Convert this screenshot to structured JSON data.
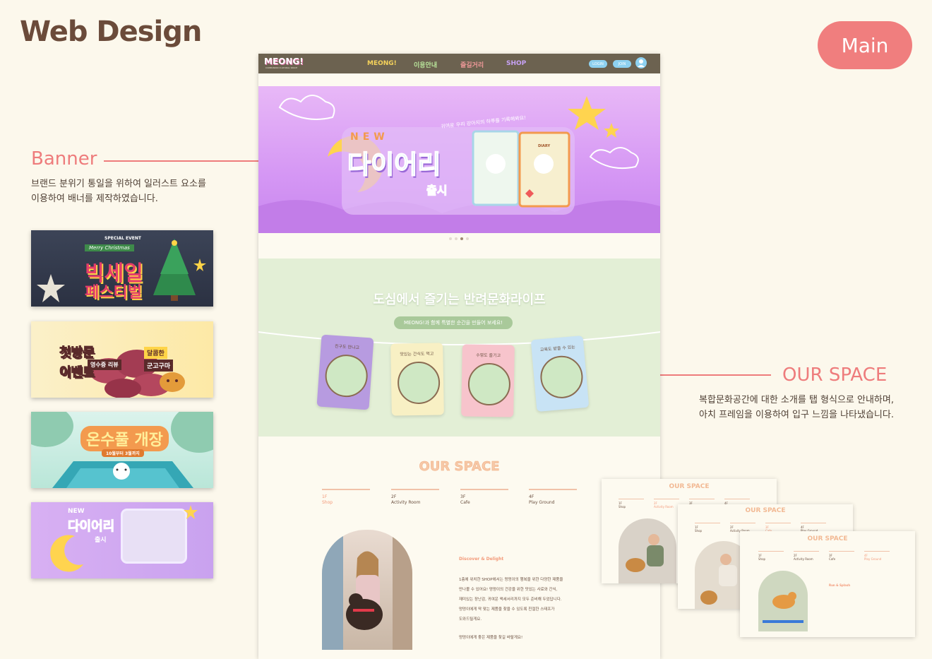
{
  "header": {
    "title": "Web Design",
    "badge": "Main"
  },
  "banner_section": {
    "heading": "Banner",
    "desc_line1": "브랜드 분위기 통일을 위하여 일러스트 요소를",
    "desc_line2": "이용하여 배너를 제작하였습니다."
  },
  "our_space_section": {
    "heading": "OUR SPACE",
    "desc_line1": "복합문화공간에 대한 소개를 탭 형식으로 안내하며,",
    "desc_line2": "아치 프레임을 이용하여 입구 느낌을 나타냈습니다."
  },
  "thumbnails": {
    "t1": {
      "tag": "SPECIAL EVENT",
      "script": "Merry Christmas",
      "line1": "빅세일",
      "line2": "페스티벌"
    },
    "t2": {
      "line1": "첫방문",
      "line2": "이벤트",
      "badge1": "달콤한",
      "badge2": "군고구마",
      "badge3": "영수증 리뷰"
    },
    "t3": {
      "title": "온수풀 개장",
      "sub": "10월부터 3월까지"
    },
    "t4": {
      "new": "NEW",
      "title": "다이어리",
      "sub": "출시"
    }
  },
  "site": {
    "logo": "MEONG!",
    "logo_sub": "COMPANION CULTURAL SPACE",
    "nav": [
      "MEONG!",
      "이용안내",
      "즐길거리",
      "SHOP"
    ],
    "nav_colors": [
      "#f6d35b",
      "#b8e39a",
      "#f29a9a",
      "#c7a2f5"
    ],
    "login": "LOGIN",
    "join": "JOIN",
    "hero": {
      "new": "NEW",
      "title": "다이어리",
      "sub": "출시",
      "ribbon": "귀여운 우리 강아지의 하루를 기록해봐요!",
      "diary_label": "DIARY"
    },
    "green": {
      "heading": "도심에서 즐기는 반려문화라이프",
      "pill": "MEONG!과 함께 특별한 순간을 만들어 보세요!",
      "cards": [
        "친구도 만나고",
        "맛있는 간식도 먹고",
        "수영도 즐기고",
        "교육도 받을 수 있는"
      ]
    },
    "space": {
      "heading": "OUR SPACE",
      "tabs": [
        {
          "floor": "1F",
          "name": "Shop"
        },
        {
          "floor": "2F",
          "name": "Activity Room"
        },
        {
          "floor": "3F",
          "name": "Cafe"
        },
        {
          "floor": "4F",
          "name": "Play Ground"
        }
      ],
      "discover": "Discover & Delight",
      "body": [
        "1층에 위치한 SHOP에서는 멍멍이의 행복을 위한 다양한 제품을",
        "만나볼 수 있어요! 멍멍이의 건강을 위한 맛있는 사료와 간식,",
        "재미있는 장난감, 귀여운 액세서리까지 모두 준비해 두었답니다.",
        "멍멍이에게 딱 맞는 제품을 찾을 수 있도록 친절한 스태프가",
        "도와드릴게요."
      ],
      "closing": "멍멍이에게 좋은 제품을 찾길 바랄게요!"
    }
  },
  "previews": {
    "p1": {
      "heading": "OUR SPACE"
    },
    "p2": {
      "heading": "OUR SPACE"
    },
    "p3": {
      "heading": "OUR SPACE",
      "sub": "Run & Splash"
    }
  }
}
